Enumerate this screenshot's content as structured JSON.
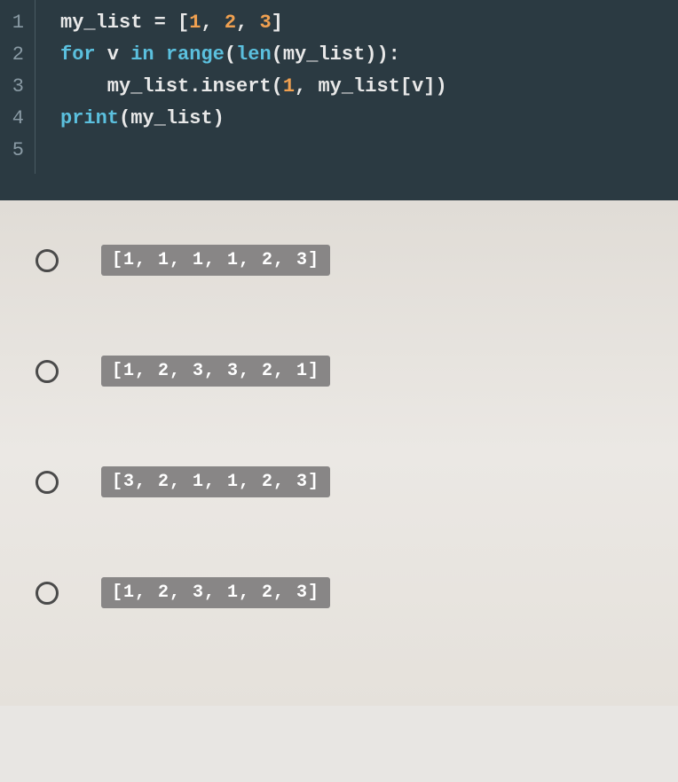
{
  "code": {
    "line_numbers": [
      "1",
      "2",
      "3",
      "4",
      "5"
    ],
    "lines": {
      "l1_t1": "my_list = [",
      "l1_n1": "1",
      "l1_t2": ", ",
      "l1_n2": "2",
      "l1_t3": ", ",
      "l1_n3": "3",
      "l1_t4": "]",
      "l2_k1": "for",
      "l2_t1": " v ",
      "l2_k2": "in",
      "l2_t2": " ",
      "l2_f1": "range",
      "l2_t3": "(",
      "l2_f2": "len",
      "l2_t4": "(my_list)):",
      "l3_t1": "    my_list.insert(",
      "l3_n1": "1",
      "l3_t2": ", my_list[v])",
      "l4_f1": "print",
      "l4_t1": "(my_list)"
    }
  },
  "options": {
    "opt1": "[1, 1, 1, 1, 2, 3]",
    "opt2": "[1, 2, 3, 3, 2, 1]",
    "opt3": "[3, 2, 1, 1, 2, 3]",
    "opt4": "[1, 2, 3, 1, 2, 3]"
  }
}
